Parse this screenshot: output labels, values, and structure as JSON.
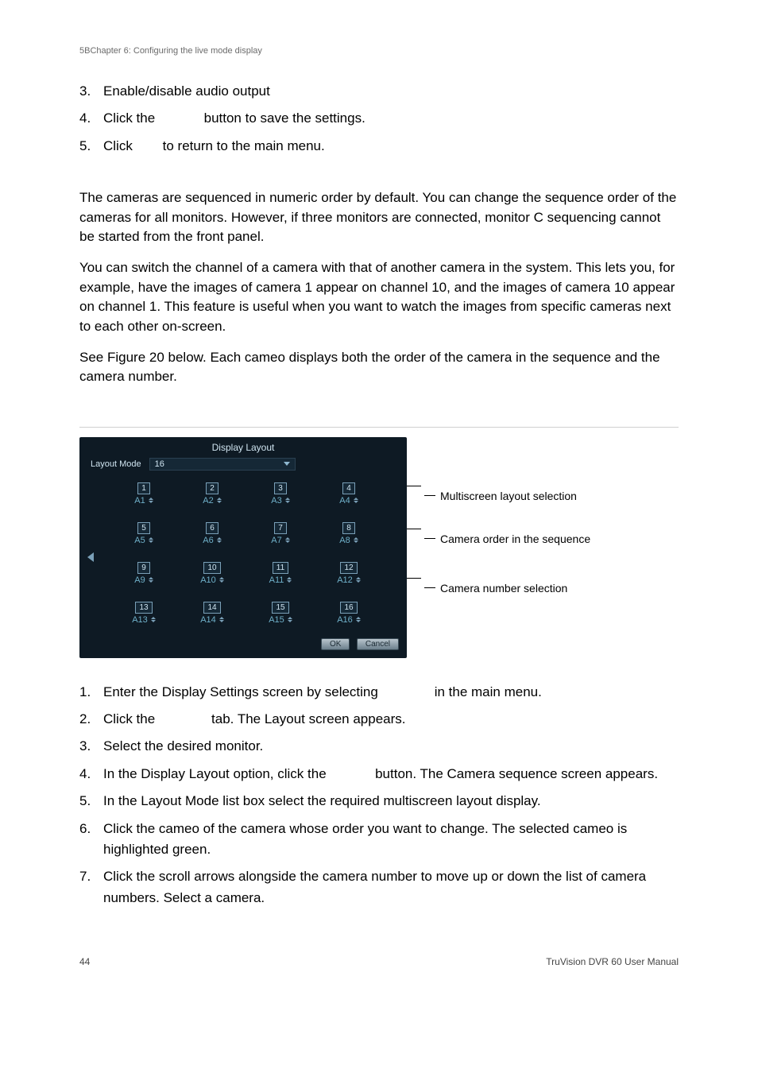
{
  "header": {
    "chapter": "5BChapter 6: Configuring the live mode display"
  },
  "topSteps": [
    {
      "num": "3.",
      "text": "Enable/disable audio output"
    },
    {
      "num": "4.",
      "pre": "Click the ",
      "gap": "           ",
      "post": " button to save the settings."
    },
    {
      "num": "5.",
      "pre": "Click ",
      "gap": "      ",
      "post": " to return to the main menu."
    }
  ],
  "paras": [
    "The cameras are sequenced in numeric order by default. You can change the sequence order of the cameras for all monitors. However, if three monitors are connected, monitor C sequencing cannot be started from the front panel.",
    "You can switch the channel of a camera with that of another camera in the system. This lets you, for example, have the images of camera 1 appear on channel 10, and the images of camera 10 appear on channel 1. This feature is useful when you want to watch the images from specific cameras next to each other on-screen.",
    "See Figure 20 below. Each cameo displays both the order of the camera in the sequence and the camera number."
  ],
  "screenshot": {
    "title": "Display Layout",
    "layoutModeLabel": "Layout Mode",
    "layoutModeValue": "16",
    "okLabel": "OK",
    "cancelLabel": "Cancel",
    "cameos": [
      {
        "order": "1",
        "cam": "A1"
      },
      {
        "order": "2",
        "cam": "A2"
      },
      {
        "order": "3",
        "cam": "A3"
      },
      {
        "order": "4",
        "cam": "A4"
      },
      {
        "order": "5",
        "cam": "A5"
      },
      {
        "order": "6",
        "cam": "A6"
      },
      {
        "order": "7",
        "cam": "A7"
      },
      {
        "order": "8",
        "cam": "A8"
      },
      {
        "order": "9",
        "cam": "A9"
      },
      {
        "order": "10",
        "cam": "A10"
      },
      {
        "order": "11",
        "cam": "A11"
      },
      {
        "order": "12",
        "cam": "A12"
      },
      {
        "order": "13",
        "cam": "A13"
      },
      {
        "order": "14",
        "cam": "A14"
      },
      {
        "order": "15",
        "cam": "A15"
      },
      {
        "order": "16",
        "cam": "A16"
      }
    ]
  },
  "annotations": {
    "a1": "Multiscreen layout  selection",
    "a2": "Camera order in the sequence",
    "a3": "Camera number selection"
  },
  "bottomSteps": [
    {
      "num": "1.",
      "pre": "Enter the Display Settings screen by selecting ",
      "gap": "             ",
      "post": " in the main menu."
    },
    {
      "num": "2.",
      "pre": "Click the ",
      "gap": "             ",
      "post": " tab. The Layout screen appears."
    },
    {
      "num": "3.",
      "text": "Select the desired monitor."
    },
    {
      "num": "4.",
      "pre": "In the Display Layout option, click the ",
      "gap": "           ",
      "post": " button. The Camera sequence screen appears."
    },
    {
      "num": "5.",
      "text": "In the Layout Mode list box select the required multiscreen layout display."
    },
    {
      "num": "6.",
      "text": "Click the cameo of the camera whose order you want to change. The selected cameo is highlighted green."
    },
    {
      "num": "7.",
      "text": "Click the scroll arrows alongside the camera number to move up or down the list of camera numbers. Select a camera."
    }
  ],
  "footer": {
    "page": "44",
    "manual": "TruVision DVR 60 User Manual"
  }
}
